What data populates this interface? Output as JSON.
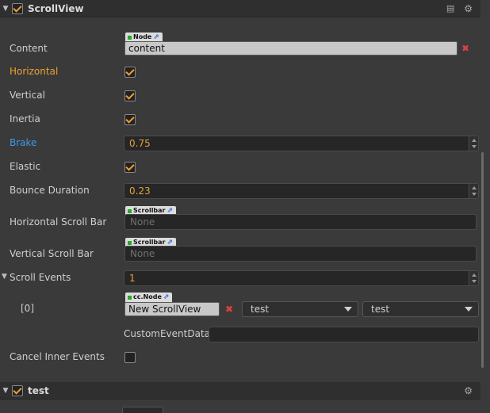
{
  "scrollview": {
    "header": {
      "title": "ScrollView",
      "enabled": true
    },
    "content": {
      "label": "Content",
      "tag": "Node",
      "value": "content"
    },
    "horizontal": {
      "label": "Horizontal",
      "checked": true
    },
    "vertical": {
      "label": "Vertical",
      "checked": true
    },
    "inertia": {
      "label": "Inertia",
      "checked": true
    },
    "brake": {
      "label": "Brake",
      "value": "0.75"
    },
    "elastic": {
      "label": "Elastic",
      "checked": true
    },
    "bounce_duration": {
      "label": "Bounce Duration",
      "value": "0.23"
    },
    "horizontal_scroll_bar": {
      "label": "Horizontal Scroll Bar",
      "tag": "Scrollbar",
      "value": "None"
    },
    "vertical_scroll_bar": {
      "label": "Vertical Scroll Bar",
      "tag": "Scrollbar",
      "value": "None"
    },
    "scroll_events": {
      "label": "Scroll Events",
      "count": "1",
      "item": {
        "index_label": "[0]",
        "tag": "cc.Node",
        "target": "New ScrollView",
        "component": "test",
        "handler": "test",
        "custom_label": "CustomEventData",
        "custom_value": ""
      }
    },
    "cancel_inner_events": {
      "label": "Cancel Inner Events",
      "checked": false
    }
  },
  "test_component": {
    "title": "test",
    "enabled": true
  },
  "colors": {
    "accent": "#f0a030",
    "highlight_blue": "#3c9ae8",
    "remove": "#e04040"
  }
}
